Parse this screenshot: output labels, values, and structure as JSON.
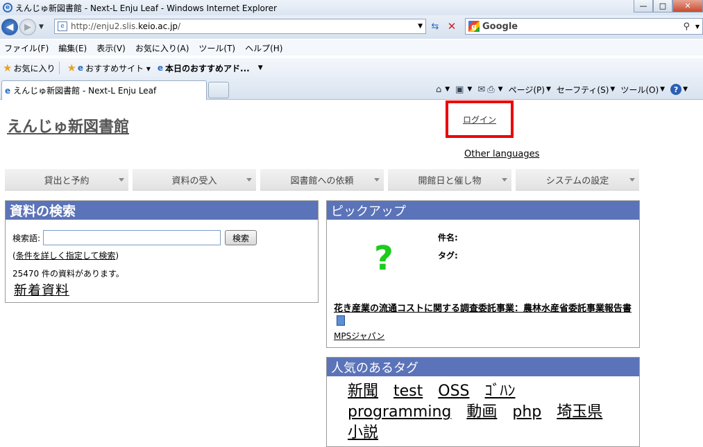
{
  "window": {
    "title": "えんじゅ新図書館 - Next-L Enju Leaf - Windows Internet Explorer",
    "minimize": "—",
    "maximize": "□",
    "close": "✕"
  },
  "address": {
    "url_prefix": "http://enju2.slis.",
    "url_domain": "keio.ac.jp",
    "url_suffix": "/"
  },
  "search_provider": "Google",
  "menu": [
    "ファイル(F)",
    "編集(E)",
    "表示(V)",
    "お気に入り(A)",
    "ツール(T)",
    "ヘルプ(H)"
  ],
  "favorites": {
    "label": "お気に入り",
    "items": [
      "おすすめサイト ▾",
      "本日のおすすめアド..."
    ]
  },
  "tab": {
    "title": "えんじゅ新図書館 - Next-L Enju Leaf"
  },
  "commands": {
    "page": "ページ(P)",
    "safety": "セーフティ(S)",
    "tools": "ツール(O)",
    "help": "?"
  },
  "page": {
    "site_title": "えんじゅ新図書館",
    "login": "ログイン",
    "other_languages": "Other languages",
    "nav": [
      "貸出と予約",
      "資料の受入",
      "図書館への依頼",
      "開館日と催し物",
      "システムの設定"
    ],
    "search_box": {
      "heading": "資料の検索",
      "label": "検索語:",
      "button": "検索",
      "advanced_prefix": "(",
      "advanced_link": "条件を詳しく指定して検索",
      "advanced_suffix": ")",
      "count_text": "25470 件の資料があります。",
      "new_arrivals": "新着資料"
    },
    "pickup": {
      "heading": "ピックアップ",
      "placeholder_glyph": "?",
      "label_title": "件名:",
      "label_tag": "タグ:",
      "book_title": "花き産業の流通コストに関する調査委託事業：農林水産省委託事業報告書",
      "publisher": "MPSジャパン"
    },
    "tags": {
      "heading": "人気のあるタグ",
      "items": [
        "新聞",
        "test",
        "OSS",
        "ｺﾞﾊﾝ",
        "programming",
        "動画",
        "php",
        "埼玉県",
        "小説"
      ]
    }
  },
  "colors": {
    "box_header": "#5b73b8",
    "highlight": "#ee0000",
    "question_mark": "#1ccc1c"
  }
}
